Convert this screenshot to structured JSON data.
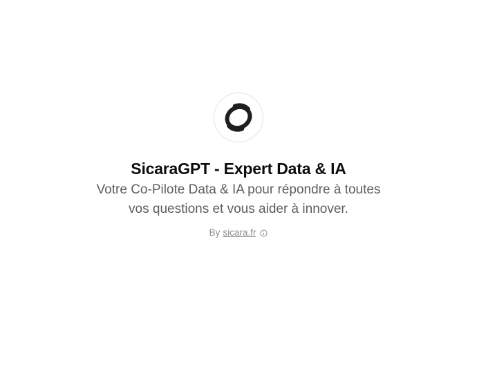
{
  "gpt": {
    "title": "SicaraGPT - Expert Data & IA",
    "description": "Votre Co-Pilote Data & IA pour répondre à toutes vos questions et vous aider à innover.",
    "by_prefix": "By",
    "author": "sicara.fr"
  },
  "icons": {
    "avatar": "sicara-logo-icon",
    "info": "info-circle-icon"
  },
  "colors": {
    "title": "#0d0d0d",
    "description": "#5d5d5d",
    "byline": "#8f8f8f",
    "logo": "#1f1f1f"
  }
}
